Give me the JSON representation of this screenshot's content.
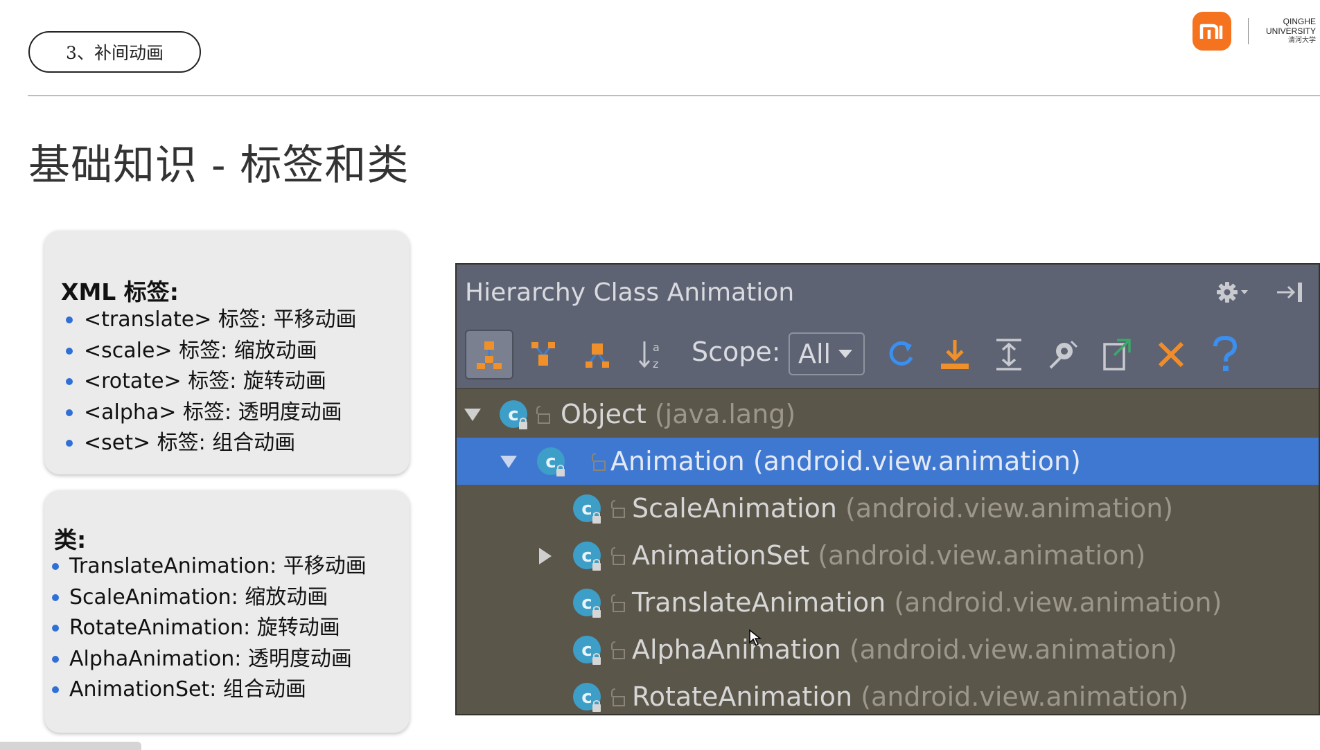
{
  "slide": {
    "section_label": "3、补间动画",
    "title": "基础知识 - 标签和类",
    "logo": {
      "mi_text": "mi",
      "uni_line1": "QINGHE",
      "uni_line2": "UNIVERSITY",
      "uni_line3": "清河大学",
      "brand_color": "#f5731f"
    }
  },
  "xml_box": {
    "heading": "XML 标签:",
    "items": [
      "<translate> 标签:  平移动画",
      "<scale> 标签:  缩放动画",
      "<rotate> 标签:  旋转动画",
      "<alpha> 标签:  透明度动画",
      "<set> 标签:  组合动画"
    ]
  },
  "class_box": {
    "heading": "类:",
    "items": [
      "TranslateAnimation:  平移动画",
      "ScaleAnimation:  缩放动画",
      "RotateAnimation:  旋转动画",
      "AlphaAnimation:  透明度动画",
      "AnimationSet:  组合动画"
    ]
  },
  "ide": {
    "title": "Hierarchy Class Animation",
    "toolbar": {
      "scope_label": "Scope:",
      "scope_value": "All",
      "icons": [
        "class-hierarchy-icon",
        "supertypes-icon",
        "subtypes-icon",
        "sort-alpha-icon",
        "refresh-icon",
        "export-icon",
        "expand-all-icon",
        "autoscroll-icon",
        "open-in-new-icon",
        "close-icon",
        "help-icon"
      ]
    },
    "tree": [
      {
        "name": "Object",
        "pkg": "(java.lang)",
        "expand": "expanded",
        "selected": false
      },
      {
        "name": "Animation",
        "pkg": "(android.view.animation)",
        "expand": "expanded",
        "selected": true
      },
      {
        "name": "ScaleAnimation",
        "pkg": "(android.view.animation)",
        "expand": "none",
        "selected": false
      },
      {
        "name": "AnimationSet",
        "pkg": "(android.view.animation)",
        "expand": "collapsed",
        "selected": false
      },
      {
        "name": "TranslateAnimation",
        "pkg": "(android.view.animation)",
        "expand": "none",
        "selected": false
      },
      {
        "name": "AlphaAnimation",
        "pkg": "(android.view.animation)",
        "expand": "none",
        "selected": false
      },
      {
        "name": "RotateAnimation",
        "pkg": "(android.view.animation)",
        "expand": "none",
        "selected": false
      }
    ],
    "colors": {
      "header": "#5d6372",
      "tree_bg": "#5b564a",
      "selection": "#3f78d1",
      "class_icon": "#3d9fc8"
    }
  }
}
